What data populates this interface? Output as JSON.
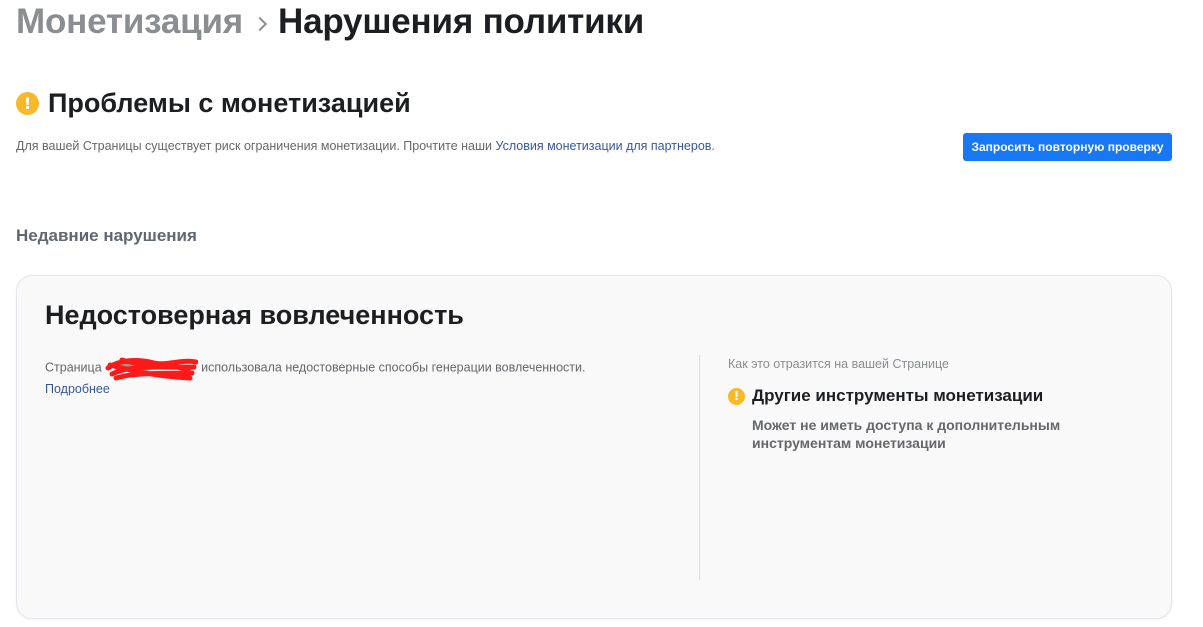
{
  "breadcrumb": {
    "parent": "Монетизация",
    "current": "Нарушения политики"
  },
  "problems": {
    "icon": "warning-icon",
    "title": "Проблемы с монетизацией",
    "description_prefix": "Для вашей Страницы существует риск ограничения монетизации. Прочтите наши ",
    "terms_link": "Условия монетизации для партнеров",
    "description_suffix": ".",
    "recheck_button": "Запросить повторную проверку"
  },
  "recent_violations": {
    "heading": "Недавние нарушения",
    "items": [
      {
        "title": "Недостоверная вовлеченность",
        "description_prefix": "Страница",
        "description_suffix": " использовала недостоверные способы генерации вовлеченности.",
        "learn_more": "Подробнее",
        "impact_heading": "Как это отразится на вашей Странице",
        "impact_title": "Другие инструменты монетизации",
        "impact_description": "Может не иметь доступа к дополнительным инструментам монетизации"
      }
    ]
  },
  "colors": {
    "accent": "#1877f2",
    "warning": "#f7b928",
    "link": "#385898"
  }
}
